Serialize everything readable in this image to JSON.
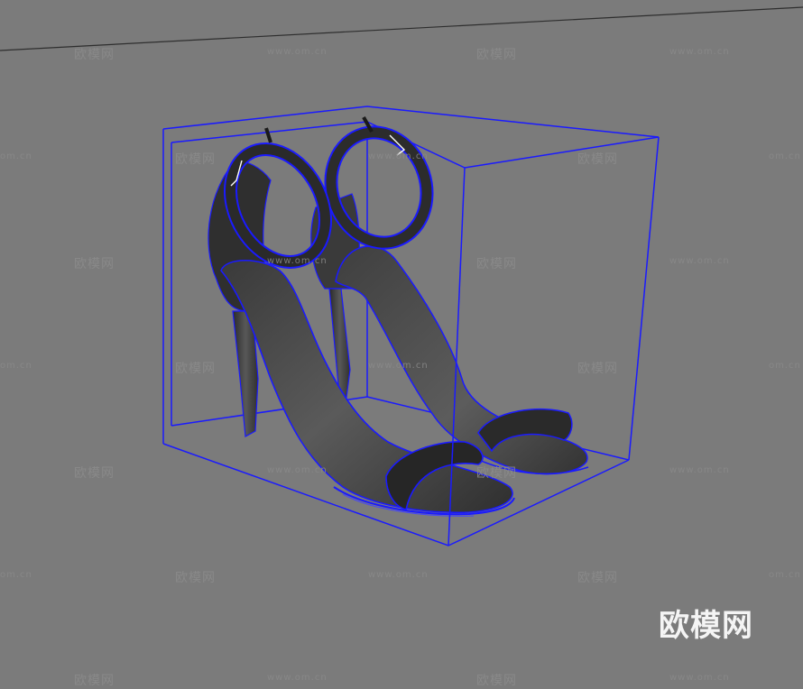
{
  "watermark": {
    "brand": "欧模网",
    "url": "www.om.cn",
    "edge_url": "om.cn"
  },
  "logo": {
    "text": "欧模网"
  },
  "scene": {
    "object": "high-heel-sandals",
    "selection_color": "#1a1aff",
    "background_color": "#7b7b7b"
  }
}
